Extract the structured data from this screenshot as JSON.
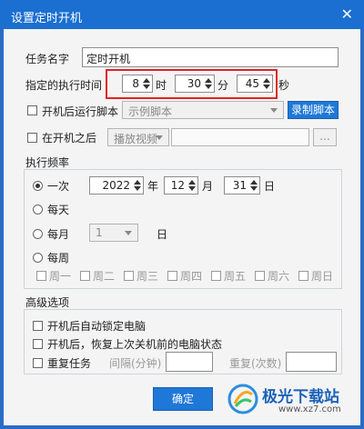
{
  "window": {
    "title": "设置定时开机"
  },
  "task": {
    "name_label": "任务名字",
    "name_value": "定时开机"
  },
  "time": {
    "label": "指定的执行时间",
    "hour": "8",
    "hour_unit": "时",
    "minute": "30",
    "minute_unit": "分",
    "second": "45",
    "second_unit": "秒"
  },
  "startup_script": {
    "label": "开机后运行脚本",
    "select_value": "示例脚本",
    "record_button": "录制脚本"
  },
  "after_boot": {
    "label": "在开机之后",
    "select_value": "播放视频",
    "path_value": "",
    "browse_button": "..."
  },
  "frequency": {
    "title": "执行频率",
    "once": "一次",
    "year": "2022",
    "year_unit": "年",
    "month": "12",
    "month_unit": "月",
    "day": "31",
    "day_unit": "日",
    "daily": "每天",
    "monthly": "每月",
    "monthly_day": "1",
    "monthly_day_unit": "日",
    "weekly": "每周",
    "weekdays": [
      "周一",
      "周二",
      "周三",
      "周四",
      "周五",
      "周六",
      "周日"
    ]
  },
  "advanced": {
    "title": "高级选项",
    "lock_after_boot": "开机后自动锁定电脑",
    "restore_state": "开机后，恢复上次关机前的电脑状态",
    "repeat_task": "重复任务",
    "interval_label": "间隔(分钟)",
    "interval_value": "",
    "repeat_count_label": "重复(次数)",
    "repeat_count_value": ""
  },
  "confirm_button": "确定",
  "watermark": {
    "text": "极光下载站",
    "url": "www.xz7.com"
  },
  "colors": {
    "titlebar": "#1a6fd0",
    "highlight": "#e02424",
    "primary_button": "#1f78d8"
  }
}
